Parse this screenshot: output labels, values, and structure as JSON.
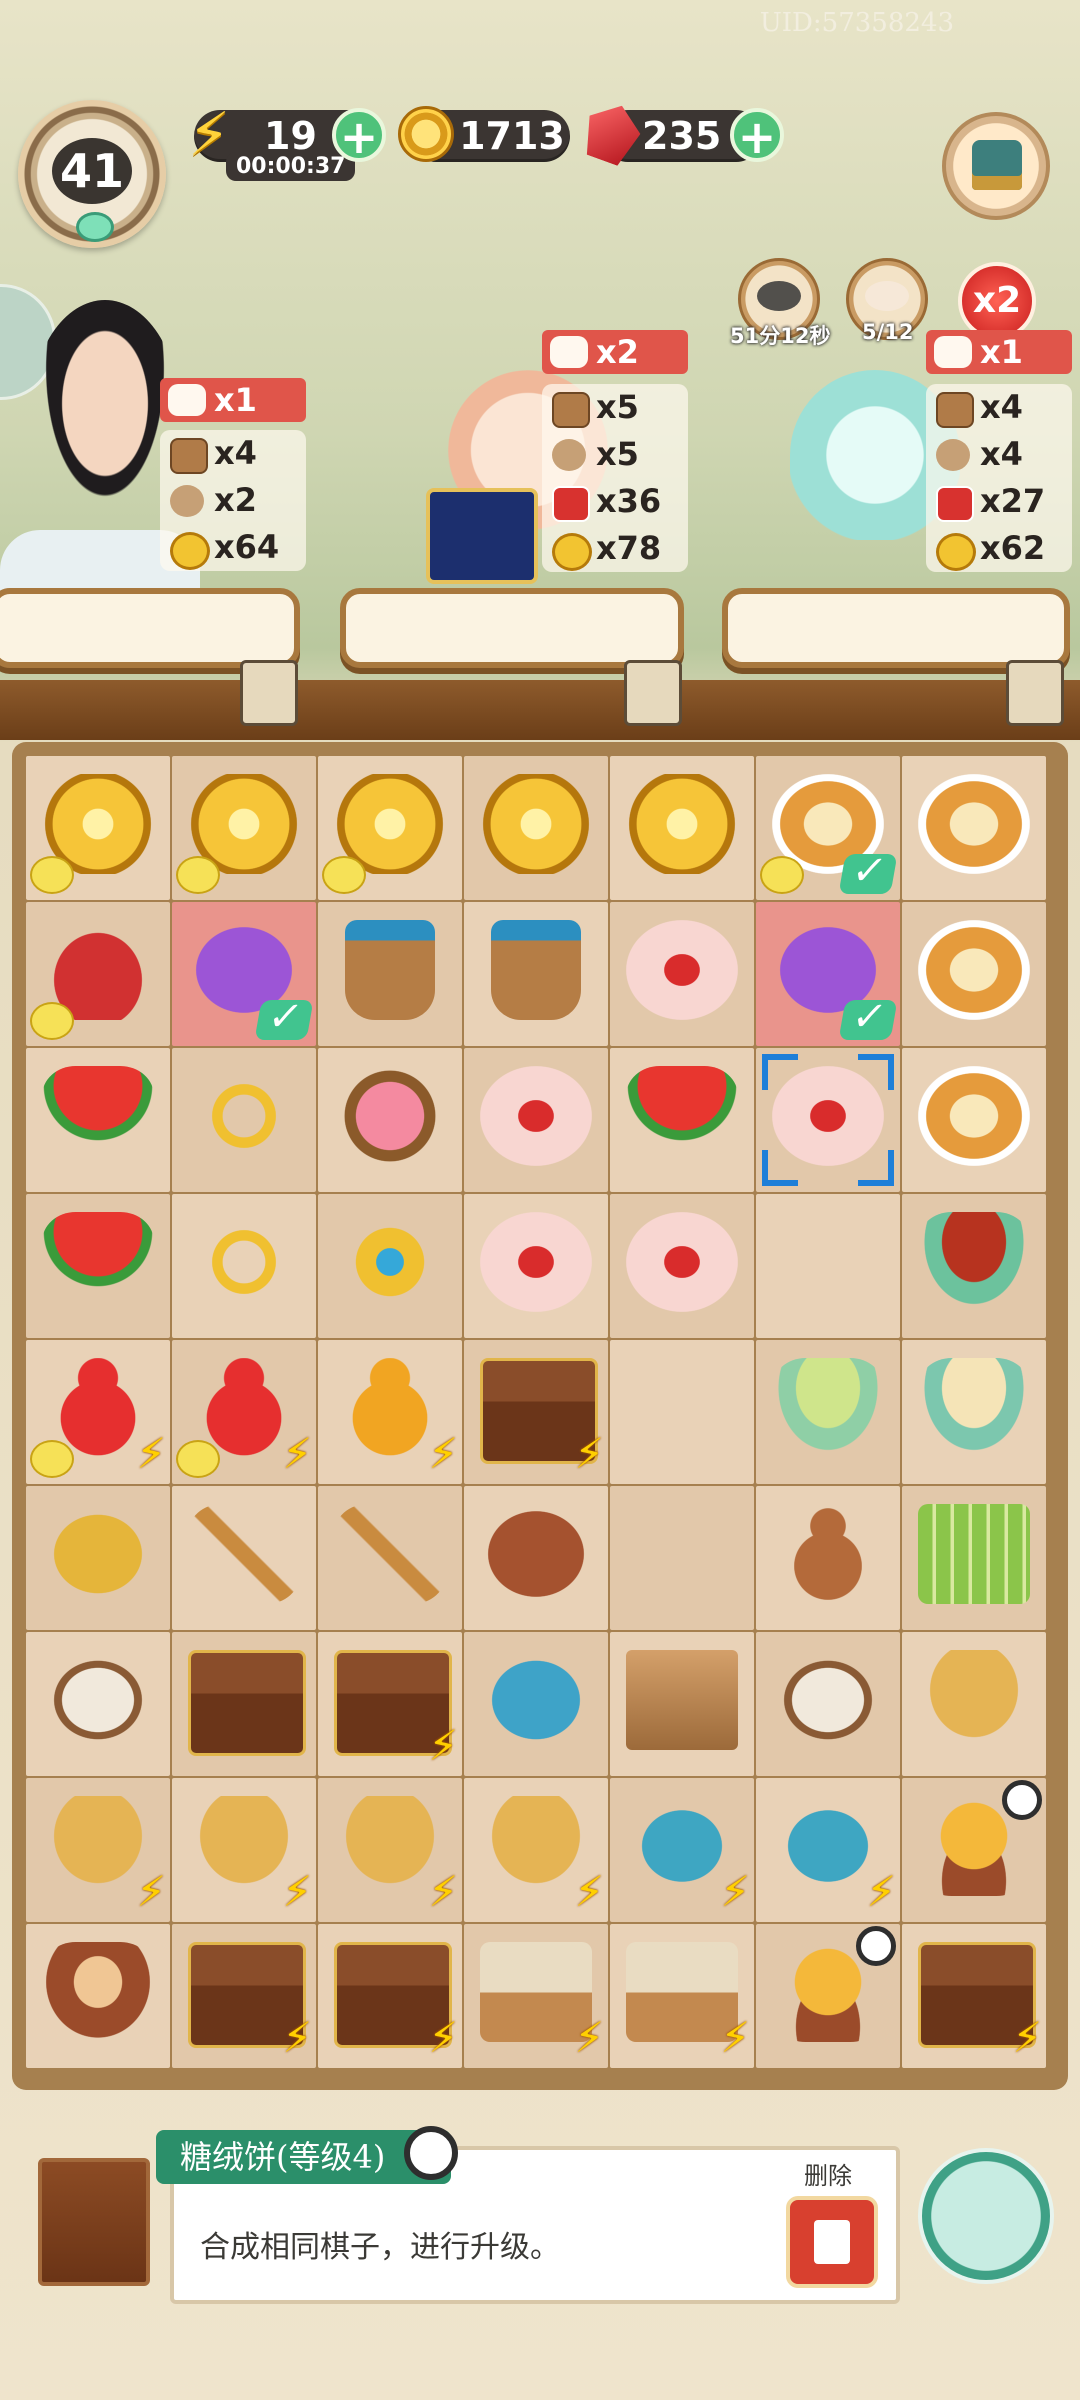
{
  "uid": "UID:57358243",
  "player": {
    "level": "41"
  },
  "resources": {
    "energy": "19",
    "energy_timer": "00:00:37",
    "coins": "1713",
    "gems": "235"
  },
  "events": {
    "cooking_timer": "51分12秒",
    "cat_progress": "5/12",
    "multiplier": "x2"
  },
  "customers": [
    {
      "reward_cats": "x1",
      "rows": [
        {
          "icon": "bucket",
          "value": "x4"
        },
        {
          "icon": "spoon",
          "value": "x2"
        },
        {
          "icon": "coin",
          "value": "x64"
        }
      ]
    },
    {
      "reward_cats": "x2",
      "rows": [
        {
          "icon": "bucket",
          "value": "x5"
        },
        {
          "icon": "spoon",
          "value": "x5"
        },
        {
          "icon": "card",
          "value": "x36"
        },
        {
          "icon": "coin",
          "value": "x78"
        }
      ]
    },
    {
      "reward_cats": "x1",
      "rows": [
        {
          "icon": "bucket",
          "value": "x4"
        },
        {
          "icon": "spoon",
          "value": "x4"
        },
        {
          "icon": "card",
          "value": "x27"
        },
        {
          "icon": "coin",
          "value": "x62"
        }
      ]
    }
  ],
  "board": [
    [
      "coin-stack-chick",
      "coin-stack-chick",
      "coin-stack-chick",
      "coin-pile",
      "coin-single",
      "roast-chicken-ready",
      "fried-rice-bowl"
    ],
    [
      "lucky-bag-chick",
      "purple-pouch-ready",
      "double-bucket",
      "wooden-bucket",
      "pink-cake",
      "blue-lantern-ready",
      "omelette-rice"
    ],
    [
      "watermelon-slice",
      "gold-ring",
      "peach-bun-plate",
      "pink-cake-pair",
      "watermelon-tray",
      "pink-cake-selected",
      "fried-egg"
    ],
    [
      "fruit-platter",
      "gold-bracelet",
      "jewel-flowers",
      "pink-cake-big",
      "pink-cake-pair",
      "empty",
      "red-bean-soup"
    ],
    [
      "red-gourd-chick",
      "red-gourd-chick",
      "golden-gourd",
      "gift-box-charged",
      "empty",
      "green-pea-soup",
      "rice-ball-soup"
    ],
    [
      "dried-leaves",
      "brush-ruler",
      "calligraphy-brush",
      "bird-nest",
      "empty",
      "brown-gourd",
      "bamboo-slips"
    ],
    [
      "silk-spool",
      "wooden-chest",
      "silk-loom-charged",
      "tea-jar",
      "tea-crate",
      "thread-spools",
      "woven-basket"
    ],
    [
      "rice-basket-charged",
      "fruit-basket-charged",
      "meat-basket-charged",
      "grape-basket-charged",
      "teapot-stand-charged",
      "teapot-charged",
      "hen-timer"
    ],
    [
      "egg-nest",
      "treasure-chest-charged",
      "jewelry-chest-charged",
      "scroll-basket-charged",
      "scroll-crate-charged",
      "hen-nest-timer",
      "loom-wheel-charged"
    ]
  ],
  "selected_item": {
    "name": "糖绒饼(等级4)",
    "description": "合成相同棋子，进行升级。",
    "delete_label": "删除"
  }
}
